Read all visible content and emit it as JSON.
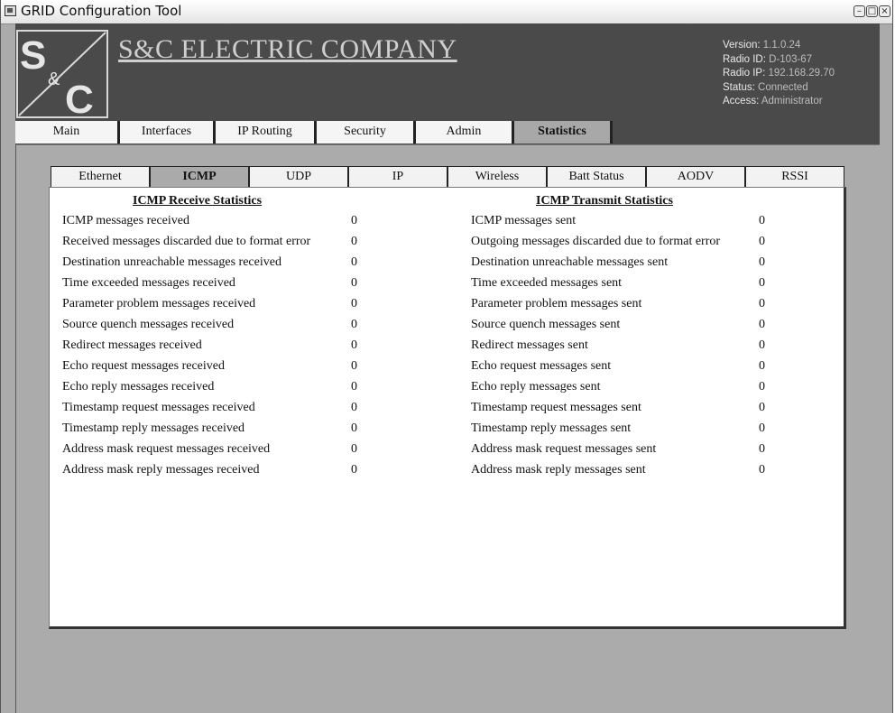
{
  "window": {
    "title": "GRID Configuration Tool"
  },
  "header": {
    "company": "S&C ELECTRIC COMPANY",
    "info": [
      {
        "label": "Version:",
        "value": "1.1.0.24"
      },
      {
        "label": "Radio ID:",
        "value": "D-103-67"
      },
      {
        "label": "Radio IP:",
        "value": "192.168.29.70"
      },
      {
        "label": "Status:",
        "value": "Connected"
      },
      {
        "label": "Access:",
        "value": "Administrator"
      }
    ]
  },
  "main_tabs": [
    {
      "label": "Main"
    },
    {
      "label": "Interfaces"
    },
    {
      "label": "IP Routing"
    },
    {
      "label": "Security"
    },
    {
      "label": "Admin"
    },
    {
      "label": "Statistics"
    }
  ],
  "sub_tabs": [
    {
      "label": "Ethernet"
    },
    {
      "label": "ICMP"
    },
    {
      "label": "UDP"
    },
    {
      "label": "IP"
    },
    {
      "label": "Wireless"
    },
    {
      "label": "Batt Status"
    },
    {
      "label": "AODV"
    },
    {
      "label": "RSSI"
    }
  ],
  "receive": {
    "title": "ICMP Receive Statistics",
    "rows": [
      {
        "label": "ICMP messages received",
        "value": "0"
      },
      {
        "label": "Received messages discarded due to format error",
        "value": "0"
      },
      {
        "label": "Destination unreachable messages received",
        "value": "0"
      },
      {
        "label": "Time exceeded messages received",
        "value": "0"
      },
      {
        "label": "Parameter problem messages received",
        "value": "0"
      },
      {
        "label": "Source quench messages received",
        "value": "0"
      },
      {
        "label": "Redirect messages received",
        "value": "0"
      },
      {
        "label": "Echo request messages received",
        "value": "0"
      },
      {
        "label": "Echo reply messages received",
        "value": "0"
      },
      {
        "label": "Timestamp request messages received",
        "value": "0"
      },
      {
        "label": "Timestamp reply messages received",
        "value": "0"
      },
      {
        "label": "Address mask request messages received",
        "value": "0"
      },
      {
        "label": "Address mask reply messages received",
        "value": "0"
      }
    ]
  },
  "transmit": {
    "title": "ICMP Transmit Statistics",
    "rows": [
      {
        "label": "ICMP messages sent",
        "value": "0"
      },
      {
        "label": "Outgoing messages discarded due to format error",
        "value": "0"
      },
      {
        "label": "Destination unreachable messages sent",
        "value": "0"
      },
      {
        "label": "Time exceeded messages sent",
        "value": "0"
      },
      {
        "label": "Parameter problem messages sent",
        "value": "0"
      },
      {
        "label": "Source quench messages sent",
        "value": "0"
      },
      {
        "label": "Redirect messages sent",
        "value": "0"
      },
      {
        "label": "Echo request messages sent",
        "value": "0"
      },
      {
        "label": "Echo reply messages sent",
        "value": "0"
      },
      {
        "label": "Timestamp request messages sent",
        "value": "0"
      },
      {
        "label": "Timestamp reply messages sent",
        "value": "0"
      },
      {
        "label": "Address mask request messages sent",
        "value": "0"
      },
      {
        "label": "Address mask reply messages sent",
        "value": "0"
      }
    ]
  }
}
